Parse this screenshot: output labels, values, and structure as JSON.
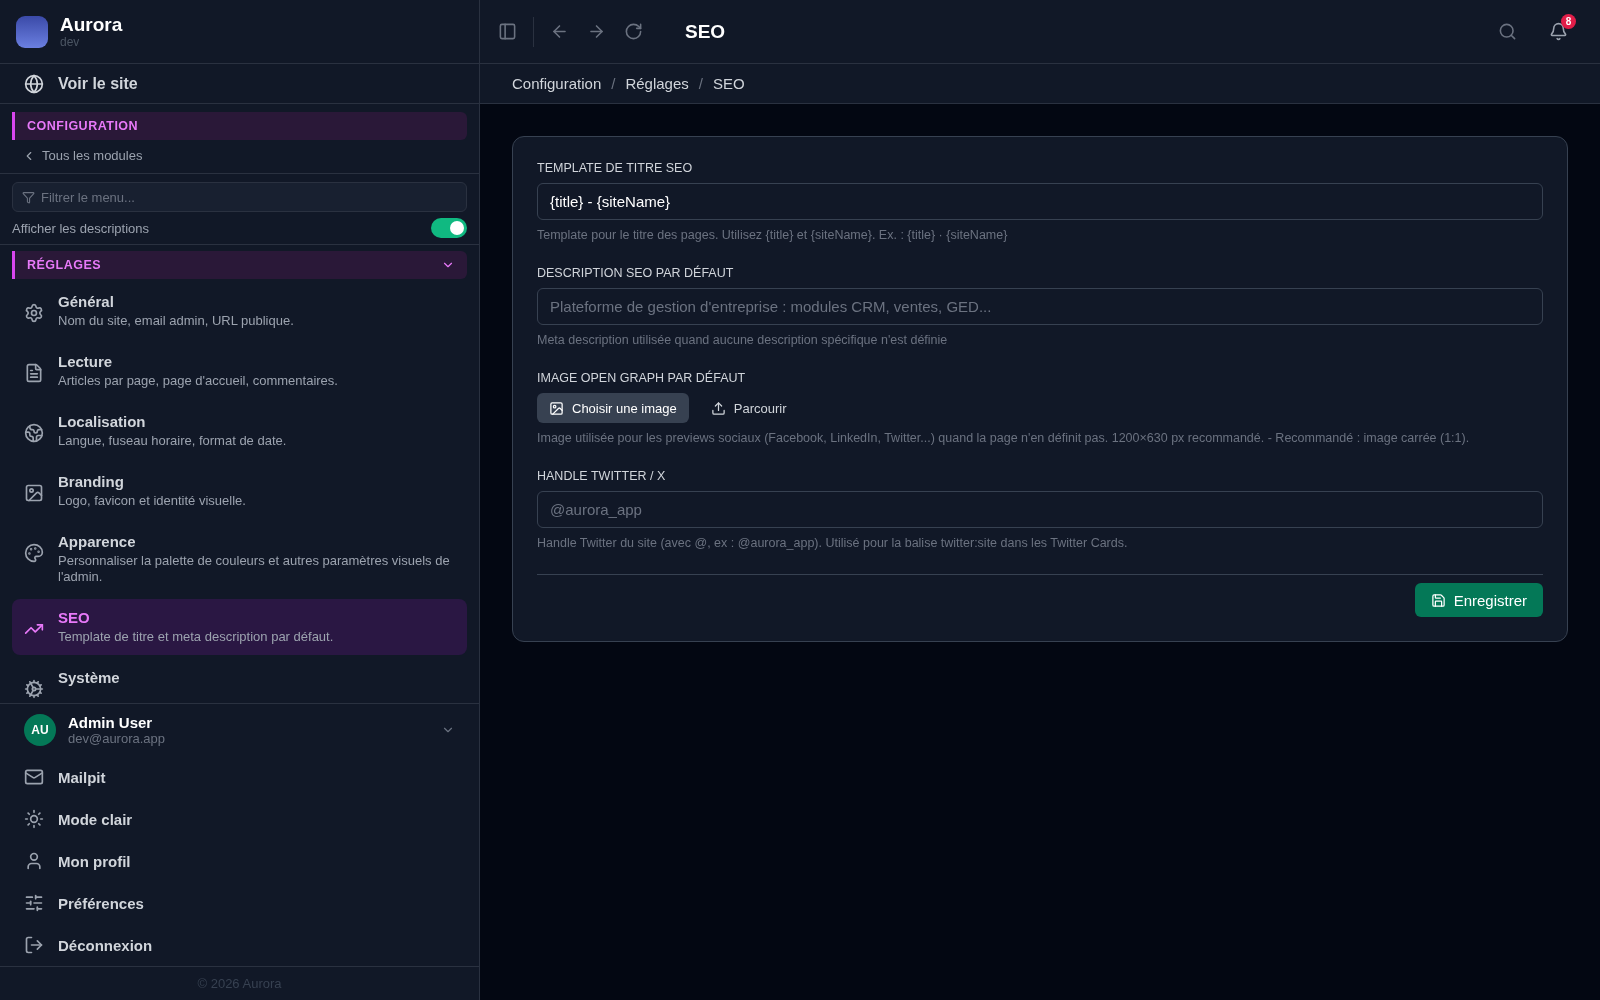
{
  "brand": {
    "name": "Aurora",
    "env": "dev"
  },
  "view_site": "Voir le site",
  "section": {
    "title": "CONFIGURATION",
    "back": "Tous les modules"
  },
  "filter": {
    "placeholder": "Filtrer le menu..."
  },
  "descriptions_toggle": {
    "label": "Afficher les descriptions",
    "on": true
  },
  "group": {
    "title": "RÉGLAGES",
    "expanded": true,
    "items": [
      {
        "title": "Général",
        "description": "Nom du site, email admin, URL publique.",
        "selected": false
      },
      {
        "title": "Lecture",
        "description": "Articles par page, page d'accueil, commentaires.",
        "selected": false
      },
      {
        "title": "Localisation",
        "description": "Langue, fuseau horaire, format de date.",
        "selected": false
      },
      {
        "title": "Branding",
        "description": "Logo, favicon et identité visuelle.",
        "selected": false
      },
      {
        "title": "Apparence",
        "description": "Personnaliser la palette de couleurs et autres paramètres visuels de l'admin.",
        "selected": false
      },
      {
        "title": "SEO",
        "description": "Template de titre et meta description par défaut.",
        "selected": true
      },
      {
        "title": "Système",
        "selected": false
      }
    ]
  },
  "user": {
    "initials": "AU",
    "name": "Admin User",
    "email": "dev@aurora.app"
  },
  "account_menu": [
    "Mailpit",
    "Mode clair",
    "Mon profil",
    "Préférences",
    "Déconnexion"
  ],
  "footer": "© 2026 Aurora",
  "topbar": {
    "title": "SEO",
    "notifications": "8"
  },
  "breadcrumb": {
    "separator": "/",
    "items": [
      "Configuration",
      "Réglages",
      "SEO"
    ]
  },
  "form": {
    "fields": [
      {
        "kind": "text",
        "label": "TEMPLATE DE TITRE SEO",
        "value": "{title} - {siteName}",
        "help": "Template pour le titre des pages. Utilisez {title} et {siteName}. Ex. : {title} · {siteName}"
      },
      {
        "kind": "text",
        "label": "DESCRIPTION SEO PAR DÉFAUT",
        "placeholder": "Plateforme de gestion d'entreprise : modules CRM, ventes, GED...",
        "help": "Meta description utilisée quand aucune description spécifique n'est définie"
      },
      {
        "kind": "image",
        "label": "IMAGE OPEN GRAPH PAR DÉFAUT",
        "choose": "Choisir une image",
        "browse": "Parcourir",
        "help": "Image utilisée pour les previews sociaux (Facebook, LinkedIn, Twitter...) quand la page n'en définit pas. 1200×630 px recommandé. - Recommandé : image carrée (1:1)."
      },
      {
        "kind": "text",
        "label": "HANDLE TWITTER / X",
        "placeholder": "@aurora_app",
        "help": "Handle Twitter du site (avec @, ex : @aurora_app). Utilisé pour la balise twitter:site dans les Twitter Cards."
      }
    ],
    "save": "Enregistrer"
  }
}
